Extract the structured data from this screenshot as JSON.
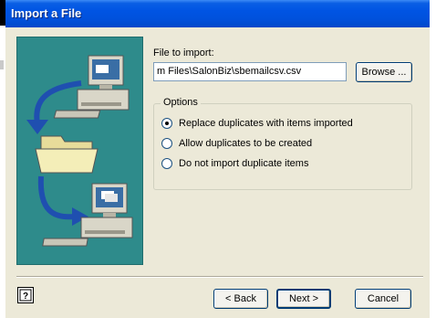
{
  "window": {
    "title": "Import a File"
  },
  "file_section": {
    "label": "File to import:",
    "value": "m Files\\SalonBiz\\sbemailcsv.csv",
    "browse_label": "Browse ..."
  },
  "options": {
    "legend": "Options",
    "items": [
      {
        "label": "Replace duplicates with items imported",
        "checked": true
      },
      {
        "label": "Allow duplicates to be created",
        "checked": false
      },
      {
        "label": "Do not import duplicate items",
        "checked": false
      }
    ]
  },
  "buttons": {
    "back": "< Back",
    "next": "Next >",
    "cancel": "Cancel"
  },
  "icons": [
    "help-icon",
    "computer-icon",
    "folder-icon",
    "arrow-icon"
  ],
  "colors": {
    "titlebar": "#0054e3",
    "panel": "#2e8b8b",
    "dialog": "#ece9d8"
  }
}
